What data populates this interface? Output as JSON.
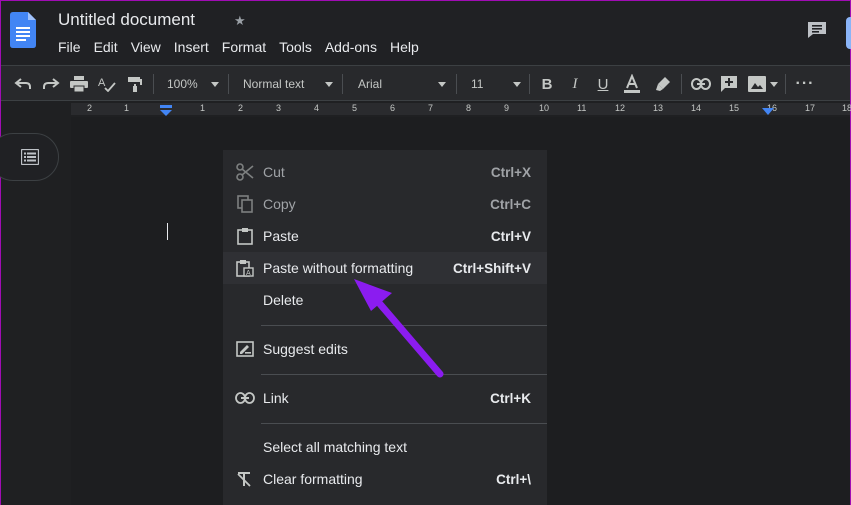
{
  "document": {
    "title": "Untitled document",
    "star_icon": "star-icon",
    "logo_icon": "google-docs-icon",
    "comment_icon": "comment-icon"
  },
  "menu": [
    "File",
    "Edit",
    "View",
    "Insert",
    "Format",
    "Tools",
    "Add-ons",
    "Help"
  ],
  "toolbar": {
    "zoom": "100%",
    "style": "Normal text",
    "font": "Arial",
    "size": "11",
    "icons": [
      "undo-icon",
      "redo-icon",
      "print-icon",
      "spellcheck-icon",
      "paint-format-icon",
      "bold-icon",
      "italic-icon",
      "underline-icon",
      "text-color-icon",
      "highlight-icon",
      "link-icon",
      "add-comment-icon",
      "image-icon",
      "more-icon"
    ]
  },
  "ruler": {
    "labels": [
      "2",
      "1",
      "1",
      "2",
      "3",
      "4",
      "5",
      "6",
      "7",
      "8",
      "9",
      "10",
      "11",
      "12",
      "13",
      "14",
      "15",
      "16",
      "17",
      "18"
    ]
  },
  "context_menu": {
    "items": [
      {
        "label": "Cut",
        "shortcut": "Ctrl+X",
        "icon": "scissors-icon",
        "enabled": false
      },
      {
        "label": "Copy",
        "shortcut": "Ctrl+C",
        "icon": "copy-icon",
        "enabled": false
      },
      {
        "label": "Paste",
        "shortcut": "Ctrl+V",
        "icon": "clipboard-icon",
        "enabled": true
      },
      {
        "label": "Paste without formatting",
        "shortcut": "Ctrl+Shift+V",
        "icon": "paste-plain-icon",
        "enabled": true,
        "highlighted": true
      },
      {
        "label": "Delete",
        "shortcut": "",
        "icon": "",
        "enabled": true
      },
      {
        "label": "Suggest edits",
        "shortcut": "",
        "icon": "suggest-edits-icon",
        "enabled": true
      },
      {
        "label": "Link",
        "shortcut": "Ctrl+K",
        "icon": "link-icon",
        "enabled": true
      },
      {
        "label": "Select all matching text",
        "shortcut": "",
        "icon": "",
        "enabled": true
      },
      {
        "label": "Clear formatting",
        "shortcut": "Ctrl+\\",
        "icon": "clear-formatting-icon",
        "enabled": true
      }
    ]
  },
  "colors": {
    "annotation_arrow": "#8b1cf0",
    "docs_blue": "#4285f4",
    "border_accent": "#a00cb4"
  }
}
